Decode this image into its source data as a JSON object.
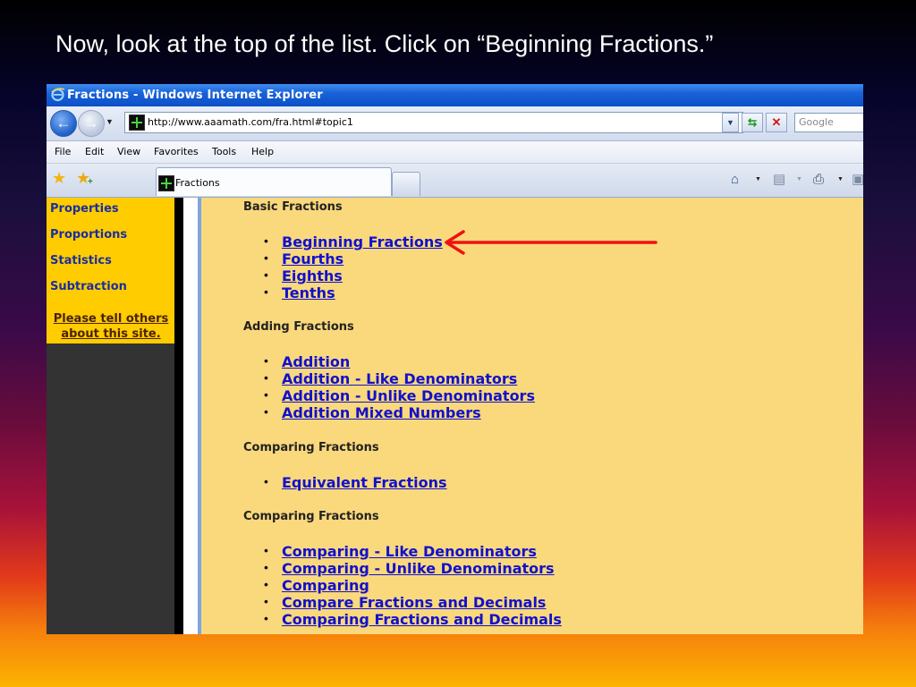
{
  "slide": {
    "instruction": "Now, look at the top of the list. Click on “Beginning Fractions.”"
  },
  "window": {
    "title": "Fractions - Windows Internet Explorer"
  },
  "address": {
    "url": "http://www.aaamath.com/fra.html#topic1"
  },
  "search": {
    "placeholder": "Google"
  },
  "menu": [
    "File",
    "Edit",
    "View",
    "Favorites",
    "Tools",
    "Help"
  ],
  "tab": {
    "label": "Fractions"
  },
  "sidebar": {
    "items": [
      "Properties",
      "Proportions",
      "Statistics",
      "Subtraction"
    ],
    "tell_line1": "Please tell others",
    "tell_line2": "about this site."
  },
  "content": {
    "sections": [
      {
        "heading": "Basic Fractions",
        "links": [
          "Beginning Fractions",
          "Fourths",
          "Eighths",
          "Tenths"
        ]
      },
      {
        "heading": "Adding Fractions",
        "links": [
          "Addition",
          "Addition - Like Denominators",
          "Addition - Unlike Denominators",
          "Addition Mixed Numbers"
        ]
      },
      {
        "heading": "Comparing Fractions",
        "links": [
          "Equivalent Fractions"
        ]
      },
      {
        "heading": "Comparing Fractions",
        "links": [
          "Comparing - Like Denominators",
          "Comparing - Unlike Denominators",
          "Comparing",
          "Compare Fractions and Decimals",
          "Comparing Fractions and Decimals"
        ]
      }
    ]
  },
  "icons": {
    "browser": "ie-logo-icon",
    "back": "back-arrow-icon",
    "forward": "forward-arrow-icon",
    "refresh": "refresh-icon",
    "stop": "stop-icon",
    "favorites": "favorites-star-icon",
    "add_favorites": "add-favorites-icon",
    "home": "home-icon",
    "feeds": "feeds-icon",
    "print": "print-icon",
    "page": "page-icon",
    "annotation": "red-arrow-icon"
  },
  "colors": {
    "content_bg": "#fad87c",
    "sidebar_nav_bg": "#ffcc00",
    "sidebar_bg": "#333333",
    "link": "#1111cc",
    "arrow": "#ee1111",
    "titlebar": "#0a50c8"
  }
}
